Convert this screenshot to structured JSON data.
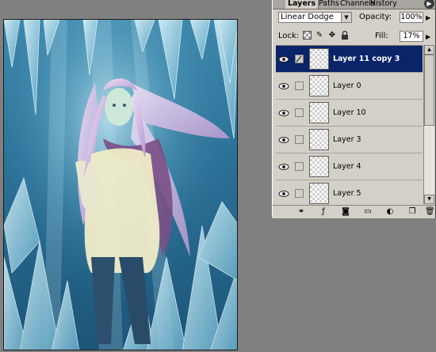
{
  "canvas": {
    "description_icon": "artwork-canvas"
  },
  "layers_palette": {
    "tabs": [
      {
        "label": "Layers",
        "active": true
      },
      {
        "label": "Paths",
        "active": false
      },
      {
        "label": "Channels",
        "active": false
      },
      {
        "label": "History",
        "active": false
      }
    ],
    "blend_mode": "Linear Dodge",
    "opacity_label": "Opacity:",
    "opacity_value": "100%",
    "lock_label": "Lock:",
    "fill_label": "Fill:",
    "fill_value": "17%",
    "layers": [
      {
        "name": "Layer 11 copy 3",
        "selected": true,
        "visible": true
      },
      {
        "name": "Layer 0",
        "selected": false,
        "visible": true
      },
      {
        "name": "Layer 10",
        "selected": false,
        "visible": true
      },
      {
        "name": "Layer 3",
        "selected": false,
        "visible": true
      },
      {
        "name": "Layer 4",
        "selected": false,
        "visible": true
      },
      {
        "name": "Layer 5",
        "selected": false,
        "visible": true
      }
    ],
    "icons": {
      "palette_menu": "arrow-right-icon",
      "lock_transparency": "lock-transparency-icon",
      "lock_image": "brush-icon",
      "lock_position": "move-icon",
      "lock_all": "lock-icon",
      "bottom": [
        "link-icon",
        "layer-style-icon",
        "mask-icon",
        "new-group-icon",
        "adjustment-layer-icon",
        "new-layer-icon",
        "trash-icon"
      ]
    }
  }
}
